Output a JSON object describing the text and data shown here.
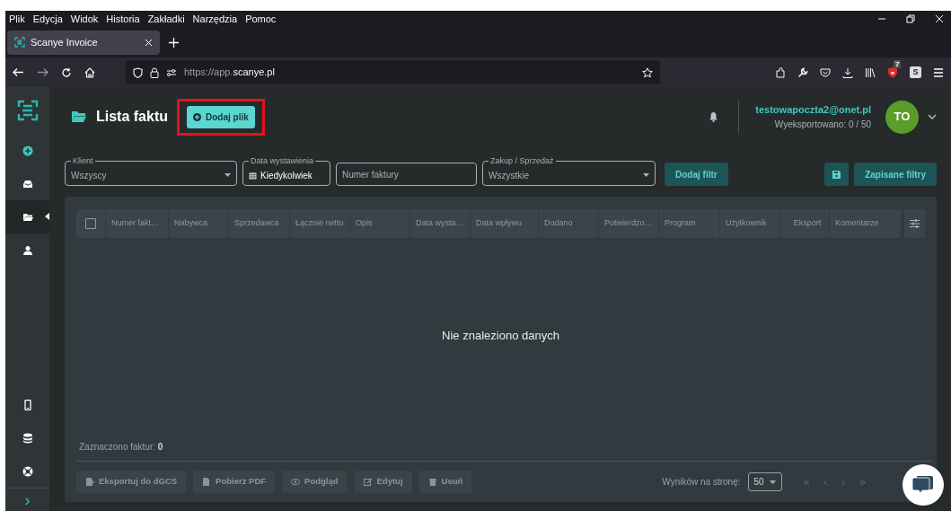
{
  "browser": {
    "menu": [
      "Plik",
      "Edycja",
      "Widok",
      "Historia",
      "Zakładki",
      "Narzędzia",
      "Pomoc"
    ],
    "tab": {
      "title": "Scanye Invoice",
      "selected": true
    },
    "url": {
      "prefix": "https://app.",
      "domain": "scanye.pl"
    },
    "extension_badge": "7",
    "extension_letter": "S"
  },
  "sidebar": {
    "items": [
      {
        "kind": "add",
        "selected": false
      },
      {
        "kind": "inbox",
        "selected": false
      },
      {
        "kind": "folder",
        "selected": true
      },
      {
        "kind": "users",
        "selected": false
      },
      {
        "kind": "phone",
        "selected": false
      },
      {
        "kind": "database",
        "selected": false
      },
      {
        "kind": "support",
        "selected": false
      }
    ],
    "expand": "›"
  },
  "header": {
    "title": "Lista faktu",
    "add_button": {
      "label": "Dodaj plik",
      "highlighted": true
    },
    "user": {
      "email": "testowapoczta2@onet.pl",
      "exported": "Wyeksportowano: 0 / 50",
      "initials": "TO"
    }
  },
  "filters": [
    {
      "kind": "select",
      "label": "Klient",
      "value": "Wszyscy"
    },
    {
      "kind": "date",
      "label": "Data wystawienia",
      "value": "Kiedykolwiek"
    },
    {
      "kind": "text",
      "placeholder": "Numer faktury"
    },
    {
      "kind": "select",
      "label": "Zakup / Sprzedaż",
      "value": "Wszystkie"
    }
  ],
  "add_filter": "Dodaj filtr",
  "saved_filters": "Zapisane filtry",
  "table": {
    "select_all": {
      "checked": false
    },
    "columns": [
      "Numer fakt…",
      "Nabywca",
      "Sprzedawca",
      "Łącznie netto",
      "Opis",
      "Data wysta…",
      "Data wpływu",
      "Dodano",
      "Potwierdzo…",
      "Program",
      "Użytkownik",
      "Eksport",
      "Komentarze"
    ],
    "empty_message": "Nie znaleziono danych"
  },
  "footer": {
    "selected_label": "Zaznaczono faktur:",
    "selected_count": "0",
    "actions": [
      {
        "kind": "export",
        "label": "Eksportuj do dGCS",
        "disabled": true
      },
      {
        "kind": "pdf",
        "label": "Pobierz PDF",
        "disabled": true
      },
      {
        "kind": "preview",
        "label": "Podgląd",
        "disabled": true
      },
      {
        "kind": "edit",
        "label": "Edytuj",
        "disabled": true
      },
      {
        "kind": "delete",
        "label": "Usuń",
        "disabled": true
      }
    ],
    "per_page_label": "Wyników na stronę:",
    "per_page": "50",
    "pager": [
      {
        "label": "«",
        "disabled": true
      },
      {
        "label": "‹",
        "disabled": true
      },
      {
        "label": "›",
        "disabled": true
      },
      {
        "label": "»",
        "disabled": true
      }
    ]
  }
}
